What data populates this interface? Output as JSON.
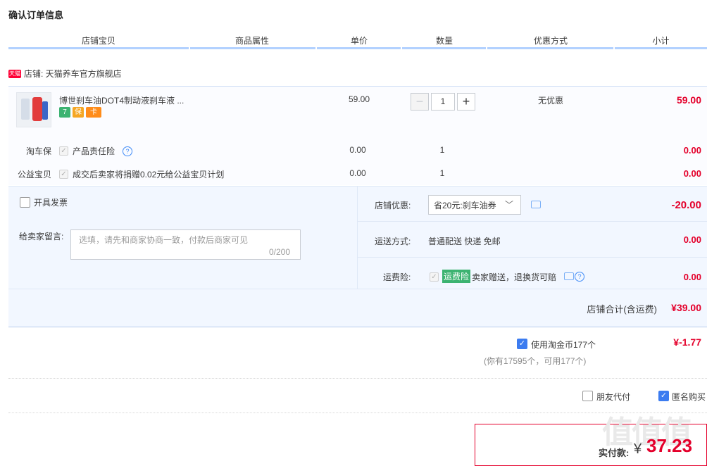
{
  "page": {
    "title": "确认订单信息"
  },
  "columns": [
    "店铺宝贝",
    "商品属性",
    "单价",
    "数量",
    "优惠方式",
    "小计"
  ],
  "shop": {
    "badge": "天猫",
    "label": "店铺: 天猫养车官方旗舰店"
  },
  "item": {
    "title": "博世刹车油DOT4制动液刹车液 ...",
    "unit_price": "59.00",
    "quantity": "1",
    "qty_minus": "−",
    "qty_plus": "+",
    "discount": "无优惠",
    "subtotal": "59.00",
    "badge_icons": [
      "7",
      "保",
      "卡"
    ]
  },
  "services": [
    {
      "label": "淘车保",
      "name": "产品责任险",
      "price": "0.00",
      "qty": "1",
      "subtotal": "0.00"
    },
    {
      "label": "公益宝贝",
      "name": "成交后卖家将捐赠0.02元给公益宝贝计划",
      "price": "0.00",
      "qty": "1",
      "subtotal": "0.00"
    }
  ],
  "invoice": {
    "label": "开具发票"
  },
  "message": {
    "label": "给卖家留言:",
    "placeholder": "选填，请先和商家协商一致，付款后商家可见",
    "counter": "0/200"
  },
  "shop_discount": {
    "label": "店铺优惠:",
    "selected": "省20元:刹车油券",
    "amount": "-20.00"
  },
  "shipping": {
    "label": "运送方式:",
    "value": "普通配送 快递 免邮",
    "amount": "0.00"
  },
  "freight_insurance": {
    "label": "运费险:",
    "tag": "运费险",
    "desc": "卖家赠送，退换货可赔",
    "amount": "0.00"
  },
  "shop_total": {
    "label": "店铺合计(含运费)",
    "amount": "¥39.00"
  },
  "coins": {
    "label": "使用淘金币177个",
    "note": "(你有17595个，可用177个)",
    "amount": "¥-1.77"
  },
  "options": {
    "friend_pay": "朋友代付",
    "anonymous": "匿名购买"
  },
  "payment": {
    "label": "实付款:",
    "currency": "¥",
    "amount": "37.23"
  },
  "colors": {
    "accent_red": "#e4002b",
    "header_rule": "#b2d1ff",
    "option_bg": "#f2f7ff",
    "check_blue": "#3c7cf0"
  }
}
